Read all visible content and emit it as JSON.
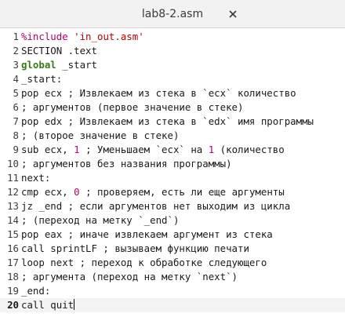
{
  "window": {
    "title": "lab8-2.asm",
    "close_icon": "close-icon"
  },
  "editor": {
    "current_line": 20,
    "lines": [
      {
        "n": "1",
        "tokens": [
          {
            "t": "%include ",
            "c": "pre"
          },
          {
            "t": "'in_out.asm'",
            "c": "str"
          }
        ]
      },
      {
        "n": "2",
        "tokens": [
          {
            "t": "SECTION .text",
            "c": ""
          }
        ]
      },
      {
        "n": "3",
        "tokens": [
          {
            "t": "global",
            "c": "kw"
          },
          {
            "t": " _start",
            "c": ""
          }
        ]
      },
      {
        "n": "4",
        "tokens": [
          {
            "t": "_start:",
            "c": "lbl"
          }
        ]
      },
      {
        "n": "5",
        "tokens": [
          {
            "t": "pop ecx ; Извлекаем из стека в `ecx` количество",
            "c": ""
          }
        ]
      },
      {
        "n": "6",
        "tokens": [
          {
            "t": "; аргументов (первое значение в стеке)",
            "c": ""
          }
        ]
      },
      {
        "n": "7",
        "tokens": [
          {
            "t": "pop edx ; Извлекаем из стека в `edx` имя программы",
            "c": ""
          }
        ]
      },
      {
        "n": "8",
        "tokens": [
          {
            "t": "; (второе значение в стеке)",
            "c": ""
          }
        ]
      },
      {
        "n": "9",
        "tokens": [
          {
            "t": "sub ecx, ",
            "c": ""
          },
          {
            "t": "1",
            "c": "num"
          },
          {
            "t": " ; Уменьшаем `ecx` на ",
            "c": ""
          },
          {
            "t": "1",
            "c": "num"
          },
          {
            "t": " (количество",
            "c": ""
          }
        ]
      },
      {
        "n": "10",
        "tokens": [
          {
            "t": "; аргументов без названия программы)",
            "c": ""
          }
        ]
      },
      {
        "n": "11",
        "tokens": [
          {
            "t": "next:",
            "c": "lbl"
          }
        ]
      },
      {
        "n": "12",
        "tokens": [
          {
            "t": "cmp ecx, ",
            "c": ""
          },
          {
            "t": "0",
            "c": "num"
          },
          {
            "t": " ; проверяем, есть ли еще аргументы",
            "c": ""
          }
        ]
      },
      {
        "n": "13",
        "tokens": [
          {
            "t": "jz _end ; если аргументов нет выходим из цикла",
            "c": ""
          }
        ]
      },
      {
        "n": "14",
        "tokens": [
          {
            "t": "; (переход на метку `_end`)",
            "c": ""
          }
        ]
      },
      {
        "n": "15",
        "tokens": [
          {
            "t": "pop eax ; иначе извлекаем аргумент из стека",
            "c": ""
          }
        ]
      },
      {
        "n": "16",
        "tokens": [
          {
            "t": "call sprintLF ; вызываем функцию печати",
            "c": ""
          }
        ]
      },
      {
        "n": "17",
        "tokens": [
          {
            "t": "loop next ; переход к обработке следующего",
            "c": ""
          }
        ]
      },
      {
        "n": "18",
        "tokens": [
          {
            "t": "; аргумента (переход на метку `next`)",
            "c": ""
          }
        ]
      },
      {
        "n": "19",
        "tokens": [
          {
            "t": "_end:",
            "c": "lbl"
          }
        ]
      },
      {
        "n": "20",
        "tokens": [
          {
            "t": "call quit",
            "c": ""
          }
        ]
      }
    ]
  }
}
